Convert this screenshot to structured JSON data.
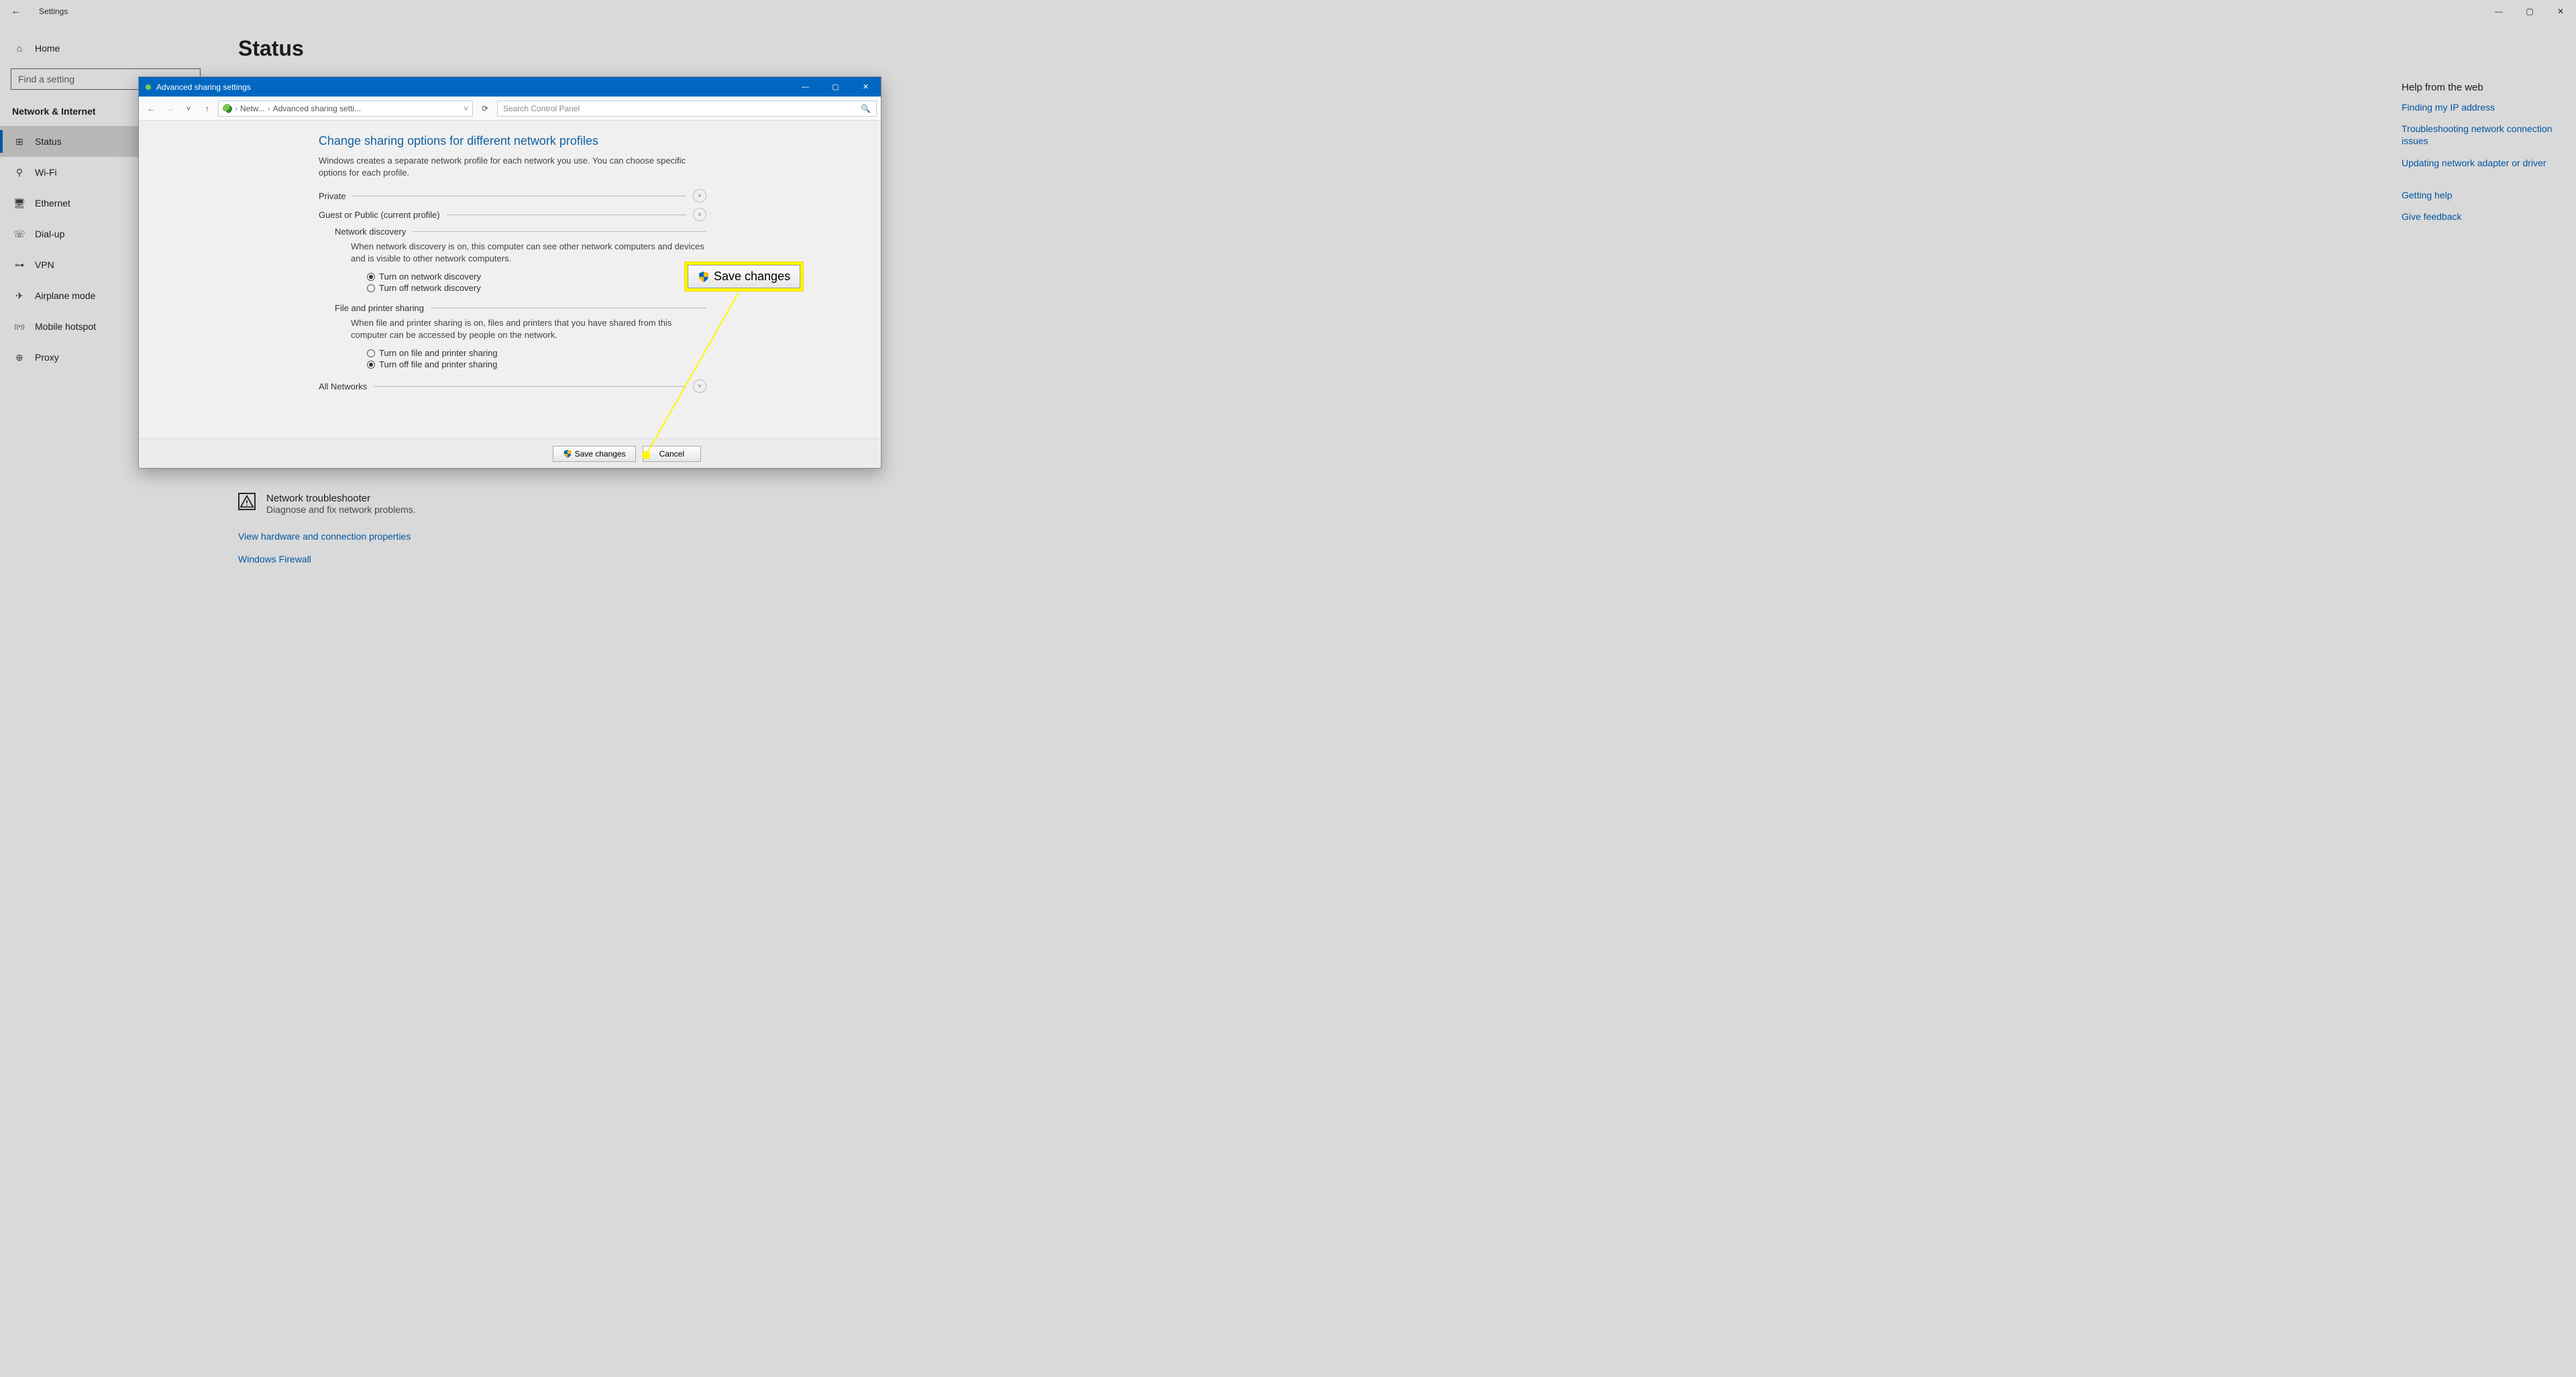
{
  "app": {
    "title": "Settings"
  },
  "sidebar": {
    "home": "Home",
    "search_placeholder": "Find a setting",
    "category": "Network & Internet",
    "items": [
      {
        "label": "Status",
        "icon": "⊞"
      },
      {
        "label": "Wi-Fi",
        "icon": "⚲"
      },
      {
        "label": "Ethernet",
        "icon": "🖥"
      },
      {
        "label": "Dial-up",
        "icon": "☏"
      },
      {
        "label": "VPN",
        "icon": "⊶"
      },
      {
        "label": "Airplane mode",
        "icon": "✈"
      },
      {
        "label": "Mobile hotspot",
        "icon": "((•))"
      },
      {
        "label": "Proxy",
        "icon": "⊕"
      }
    ]
  },
  "page": {
    "title": "Status",
    "troubleshooter_title": "Network troubleshooter",
    "troubleshooter_sub": "Diagnose and fix network problems.",
    "link_hw": "View hardware and connection properties",
    "link_fw": "Windows Firewall"
  },
  "help": {
    "title": "Help from the web",
    "links": [
      "Finding my IP address",
      "Troubleshooting network connection issues",
      "Updating network adapter or driver",
      "Getting help",
      "Give feedback"
    ]
  },
  "dialog": {
    "title": "Advanced sharing settings",
    "crumb1": "Netw...",
    "crumb2": "Advanced sharing setti...",
    "search_placeholder": "Search Control Panel",
    "heading": "Change sharing options for different network profiles",
    "desc": "Windows creates a separate network profile for each network you use. You can choose specific options for each profile.",
    "private_label": "Private",
    "public_label": "Guest or Public (current profile)",
    "all_label": "All Networks",
    "nd_title": "Network discovery",
    "nd_body": "When network discovery is on, this computer can see other network computers and devices and is visible to other network computers.",
    "nd_on": "Turn on network discovery",
    "nd_off": "Turn off network discovery",
    "fp_title": "File and printer sharing",
    "fp_body": "When file and printer sharing is on, files and printers that you have shared from this computer can be accessed by people on the network.",
    "fp_on": "Turn on file and printer sharing",
    "fp_off": "Turn off file and printer sharing",
    "save": "Save changes",
    "cancel": "Cancel"
  },
  "callout": {
    "label": "Save changes"
  }
}
